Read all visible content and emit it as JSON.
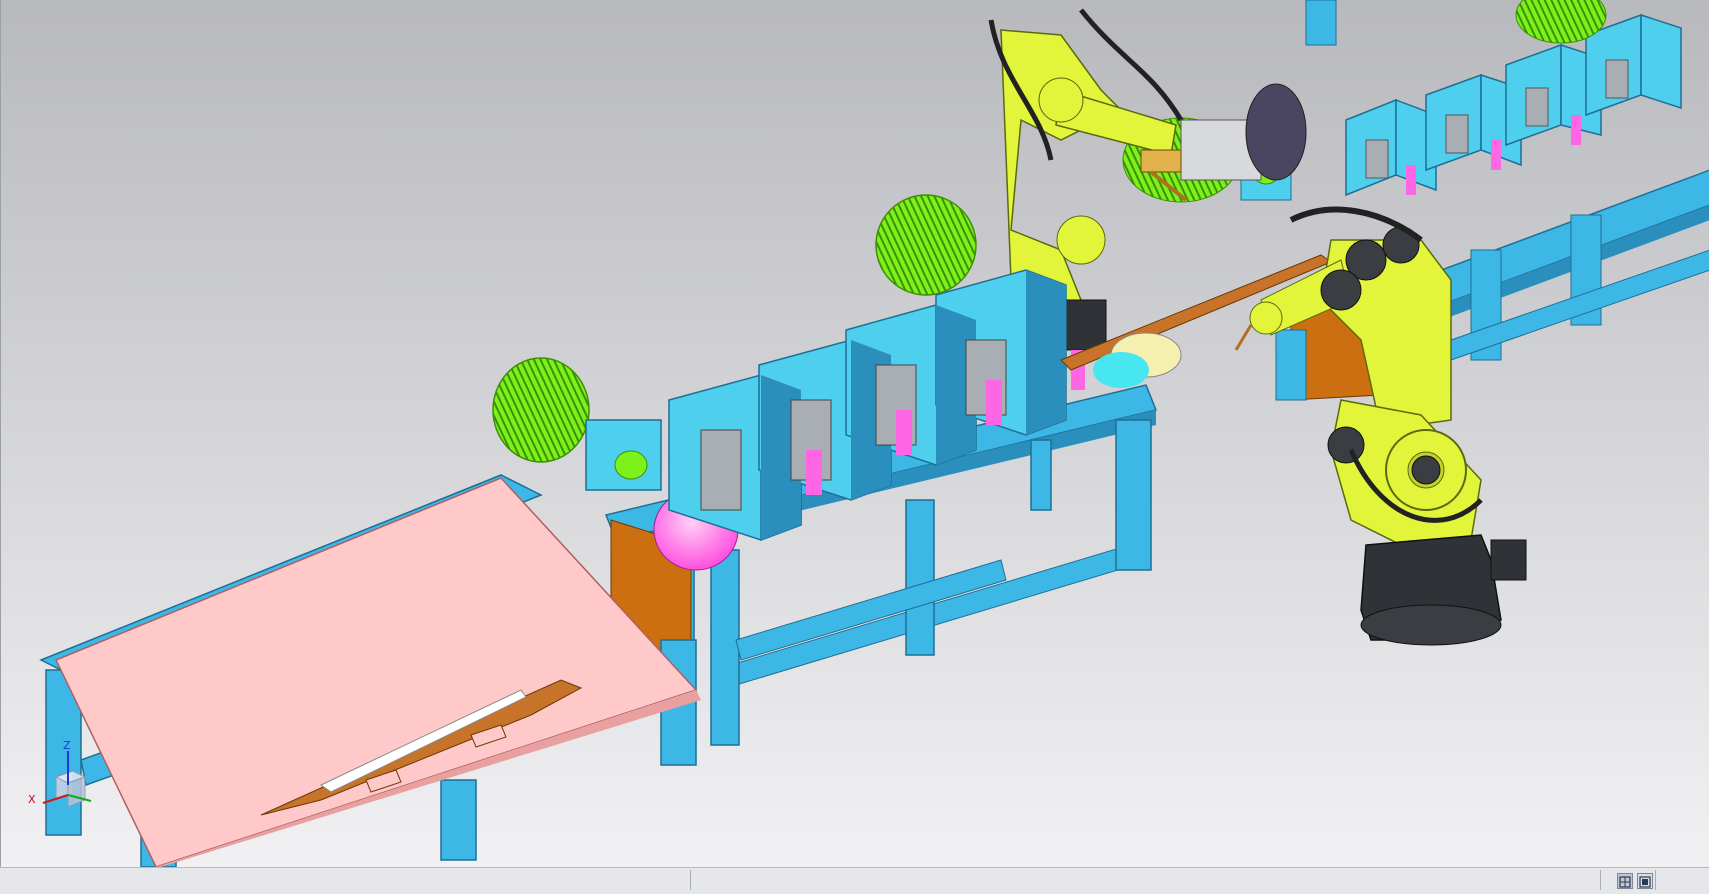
{
  "viewport": {
    "background_top": "#b8b9bd",
    "background_bottom": "#f1f1f3"
  },
  "triad": {
    "x_label": "X",
    "z_label": "Z",
    "x_color": "#d01818",
    "y_color": "#18a818",
    "z_color": "#1838d8"
  },
  "colors": {
    "frame": "#3db7e6",
    "frame_dark": "#2a8fbd",
    "housing": "#4fcfee",
    "motor": "#7cf21a",
    "robot": "#e3f53a",
    "robot_dark": "#9fb21a",
    "robot_base": "#2f3236",
    "table_top": "#ffc9c9",
    "pink_disc": "#ff66e6",
    "copper": "#c8732a",
    "orange_plate": "#cc6f10"
  },
  "statusbar": {
    "view_buttons": [
      "window-view-icon",
      "restore-view-icon"
    ]
  }
}
